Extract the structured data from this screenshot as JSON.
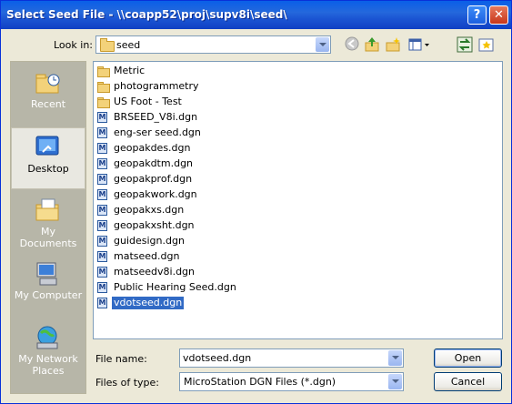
{
  "window": {
    "title": "Select Seed File - \\\\coapp52\\proj\\supv8i\\seed\\"
  },
  "titlebar": {
    "help_label": "?",
    "close_label": "✕"
  },
  "lookin": {
    "label": "Look in:",
    "value": "seed"
  },
  "toolbar": {
    "back_icon": "back-arrow-icon",
    "up_icon": "up-folder-icon",
    "new_icon": "new-folder-icon",
    "views_icon": "views-menu-icon",
    "tool1_icon": "switch-icon",
    "tool2_icon": "star-icon"
  },
  "places": [
    {
      "label": "Recent",
      "icon": "recent-folder-icon"
    },
    {
      "label": "Desktop",
      "icon": "desktop-icon",
      "selected": true
    },
    {
      "label": "My Documents",
      "icon": "my-documents-icon"
    },
    {
      "label": "My Computer",
      "icon": "my-computer-icon"
    },
    {
      "label": "My Network Places",
      "icon": "network-places-icon"
    }
  ],
  "files": [
    {
      "name": "Metric",
      "type": "folder"
    },
    {
      "name": "photogrammetry",
      "type": "folder"
    },
    {
      "name": "US Foot - Test",
      "type": "folder"
    },
    {
      "name": "BRSEED_V8i.dgn",
      "type": "dgn"
    },
    {
      "name": "eng-ser seed.dgn",
      "type": "dgn"
    },
    {
      "name": "geopakdes.dgn",
      "type": "dgn"
    },
    {
      "name": "geopakdtm.dgn",
      "type": "dgn"
    },
    {
      "name": "geopakprof.dgn",
      "type": "dgn"
    },
    {
      "name": "geopakwork.dgn",
      "type": "dgn"
    },
    {
      "name": "geopakxs.dgn",
      "type": "dgn"
    },
    {
      "name": "geopakxsht.dgn",
      "type": "dgn"
    },
    {
      "name": "guidesign.dgn",
      "type": "dgn"
    },
    {
      "name": "matseed.dgn",
      "type": "dgn"
    },
    {
      "name": "matseedv8i.dgn",
      "type": "dgn"
    },
    {
      "name": "Public Hearing Seed.dgn",
      "type": "dgn"
    },
    {
      "name": "vdotseed.dgn",
      "type": "dgn",
      "selected": true
    }
  ],
  "filename": {
    "label": "File name:",
    "value": "vdotseed.dgn"
  },
  "filetype": {
    "label": "Files of type:",
    "value": "MicroStation DGN Files (*.dgn)"
  },
  "buttons": {
    "open": "Open",
    "cancel": "Cancel"
  },
  "colors": {
    "title_bar": "#0a5fe8",
    "selection": "#316ac5",
    "places_bar": "#b7b6a8"
  }
}
